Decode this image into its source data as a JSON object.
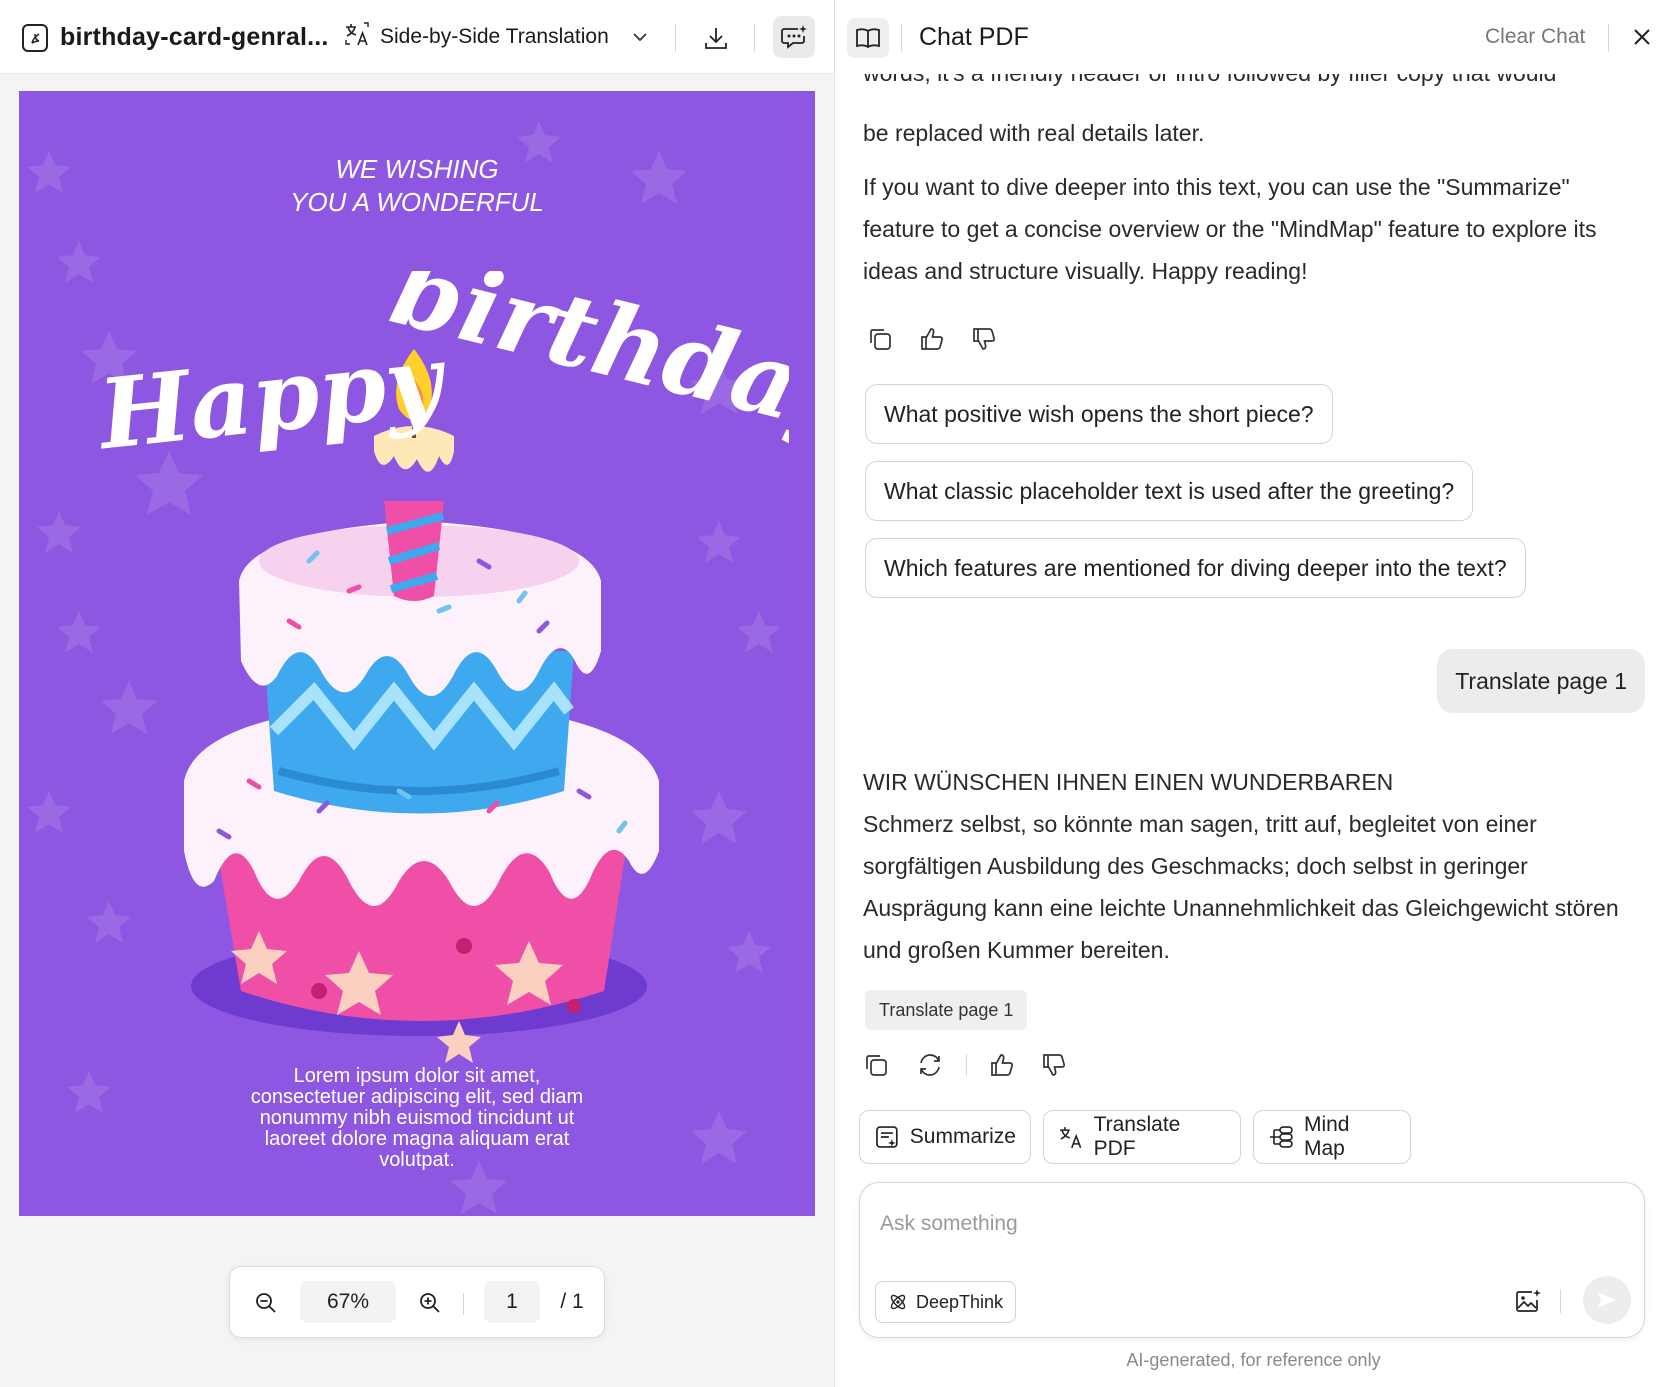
{
  "viewer": {
    "file_name": "birthday-card-genral...",
    "translation_mode": "Side-by-Side Translation",
    "zoom_level": "67%",
    "page_current": "1",
    "page_total": "/ 1"
  },
  "card": {
    "wishing_text": "WE WISHING\nYOU A WONDERFUL",
    "happy_text": "Happy",
    "birthday_text": "birthday",
    "lorem_text": "Lorem ipsum dolor sit amet, consectetuer adipiscing elit, sed diam nonummy nibh euismod tincidunt ut laoreet dolore magna aliquam erat volutpat.",
    "colors": {
      "background": "#8d57e2",
      "blue_tier": "#3ea9ee",
      "pink_tier": "#f04fa8",
      "frosting": "#fdf2fb",
      "plate": "#6e3bd0"
    }
  },
  "chat": {
    "title": "Chat PDF",
    "clear_label": "Clear Chat",
    "message_clipped": "words, it's a friendly header or intro followed by filler copy that would",
    "message_tail": "be replaced with real details later.",
    "message_para2": "If you want to dive deeper into this text, you can use the \"Summarize\" feature to get a concise overview or the \"MindMap\" feature to explore its ideas and structure visually. Happy reading!",
    "suggestions": [
      "What positive wish opens the short piece?",
      "What classic placeholder text is used after the greeting?",
      "Which features are mentioned for diving deeper into the text?"
    ],
    "user_message": "Translate page 1",
    "reply_heading": "WIR WÜNSCHEN IHNEN EINEN WUNDERBAREN",
    "reply_body": "Schmerz selbst, so könnte man sagen, tritt auf, begleitet von einer sorgfältigen Ausbildung des Geschmacks; doch selbst in geringer Ausprägung kann eine leichte Unannehmlichkeit das Gleichgewicht stören und großen Kummer bereiten.",
    "reference_chip": "Translate page 1",
    "actions": {
      "summarize": "Summarize",
      "translate_pdf": "Translate PDF",
      "mind_map": "Mind Map"
    },
    "input_placeholder": "Ask something",
    "deepthink_label": "DeepThink",
    "disclaimer": "AI-generated, for reference only"
  },
  "icons": {
    "file": "pdf-file-icon",
    "translate": "translate-icon",
    "chevron": "chevron-down-icon",
    "download": "download-icon",
    "ai_chat": "ai-chat-icon",
    "book": "book-icon",
    "close": "close-icon",
    "copy": "copy-icon",
    "thumbs_up": "thumbs-up-icon",
    "thumbs_down": "thumbs-down-icon",
    "regenerate": "regenerate-icon",
    "zoom_in": "zoom-in-icon",
    "zoom_out": "zoom-out-icon",
    "image": "image-upload-icon",
    "send": "send-icon",
    "deepthink": "atom-icon"
  }
}
